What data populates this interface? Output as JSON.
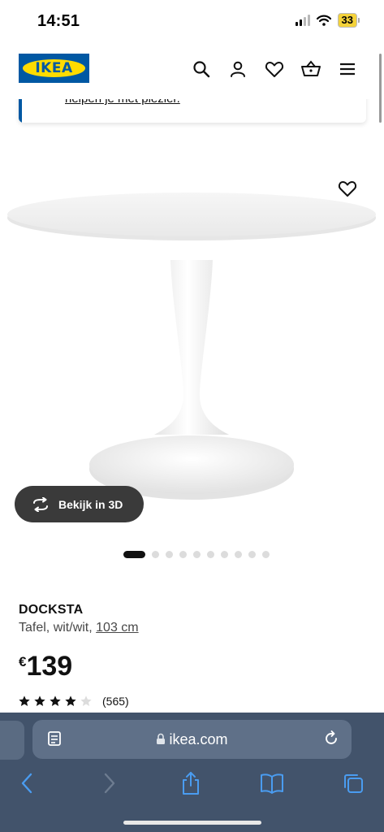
{
  "status_bar": {
    "time": "14:51",
    "battery": "33",
    "icons": [
      "cellular-signal-icon",
      "wifi-icon",
      "battery-icon"
    ]
  },
  "header": {
    "logo_text": "IKEA",
    "icons": [
      "search-icon",
      "account-icon",
      "heart-icon",
      "cart-icon",
      "menu-icon"
    ]
  },
  "banner": {
    "link_text": "helpen je met plezier."
  },
  "product": {
    "image_alt": "DOCKSTA table",
    "view_3d_label": "Bekijk in 3D",
    "carousel": {
      "count": 10,
      "active": 0
    },
    "name": "DOCKSTA",
    "description": "Tafel, wit/wit, ",
    "size": "103 cm",
    "price_currency": "€",
    "price_value": "139",
    "rating": 4,
    "rating_max": 5,
    "rating_count": "(565)"
  },
  "browser": {
    "url": "ikea.com",
    "icons": [
      "reader-icon",
      "lock-icon",
      "reload-icon",
      "back-icon",
      "forward-icon",
      "share-icon",
      "bookmarks-icon",
      "tabs-icon"
    ]
  },
  "colors": {
    "ikea_blue": "#0058a3",
    "ikea_yellow": "#ffdb00",
    "browser_bar": "#42536b"
  }
}
